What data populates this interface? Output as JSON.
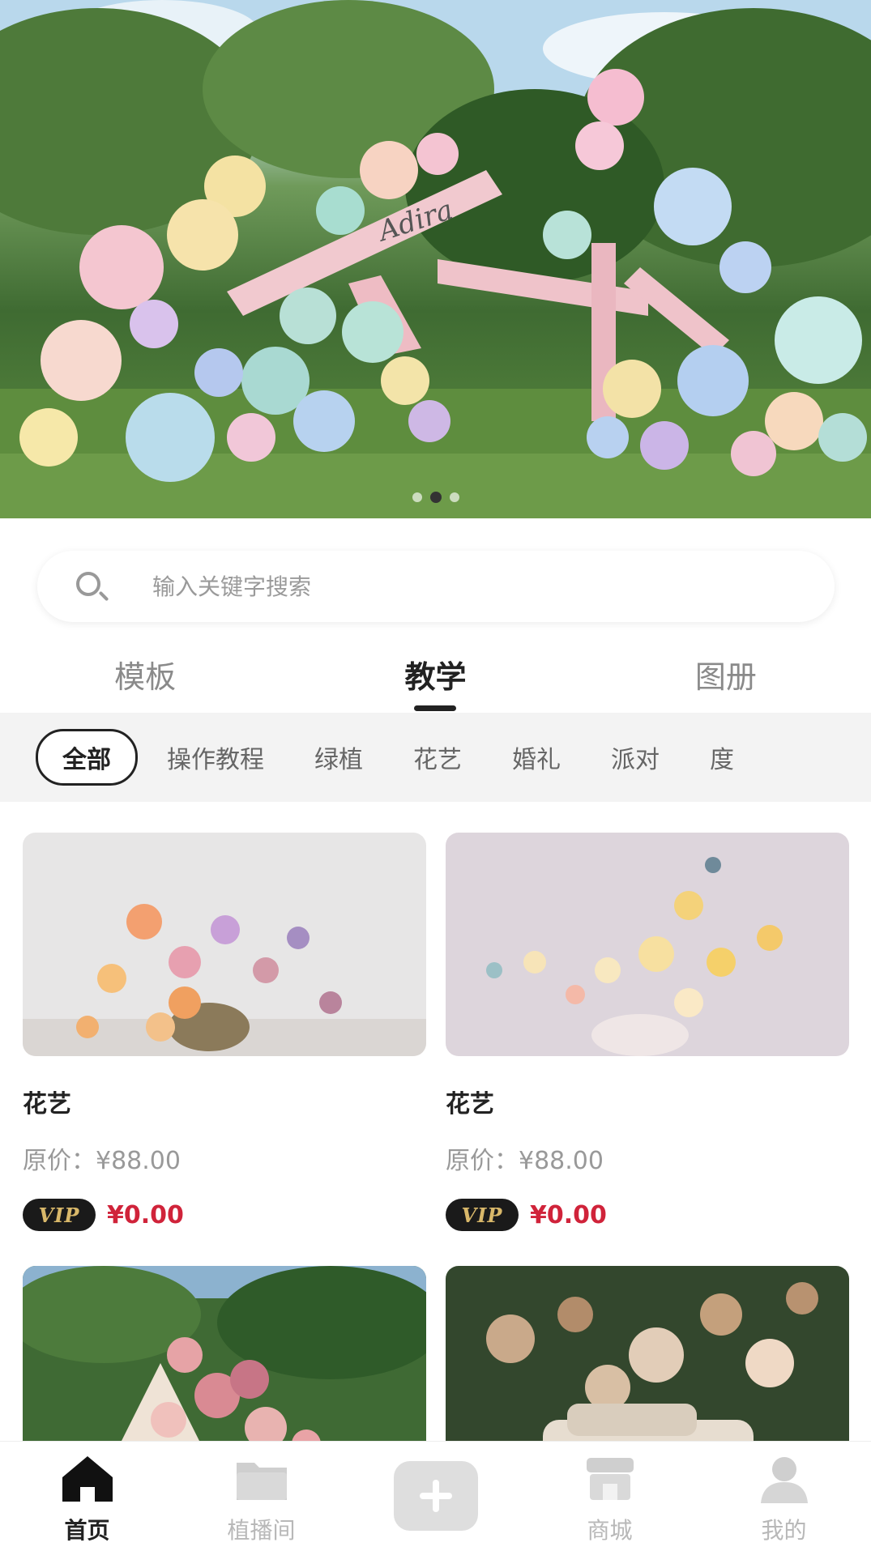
{
  "banner": {
    "sign_text": "Adira",
    "dots": 3,
    "active_dot": 1
  },
  "search": {
    "placeholder": "输入关键字搜索"
  },
  "main_tabs": [
    {
      "label": "模板",
      "active": false
    },
    {
      "label": "教学",
      "active": true
    },
    {
      "label": "图册",
      "active": false
    }
  ],
  "categories": [
    {
      "label": "全部",
      "active": true
    },
    {
      "label": "操作教程"
    },
    {
      "label": "绿植"
    },
    {
      "label": "花艺"
    },
    {
      "label": "婚礼"
    },
    {
      "label": "派对"
    },
    {
      "label": "度"
    }
  ],
  "cards": [
    {
      "title": "花艺",
      "original_price": "原价：¥88.00",
      "vip_label": "VIP",
      "vip_price": "¥0.00"
    },
    {
      "title": "花艺",
      "original_price": "原价：¥88.00",
      "vip_label": "VIP",
      "vip_price": "¥0.00"
    }
  ],
  "tabbar": [
    {
      "label": "首页",
      "icon": "home-icon",
      "active": true
    },
    {
      "label": "植播间",
      "icon": "folder-icon",
      "active": false
    },
    {
      "label": "",
      "icon": "plus-icon",
      "active": false
    },
    {
      "label": "商城",
      "icon": "store-icon",
      "active": false
    },
    {
      "label": "我的",
      "icon": "user-icon",
      "active": false
    }
  ],
  "colors": {
    "accent_text": "#222222",
    "price_red": "#d0233a",
    "vip_gold": "#d9b86a"
  }
}
